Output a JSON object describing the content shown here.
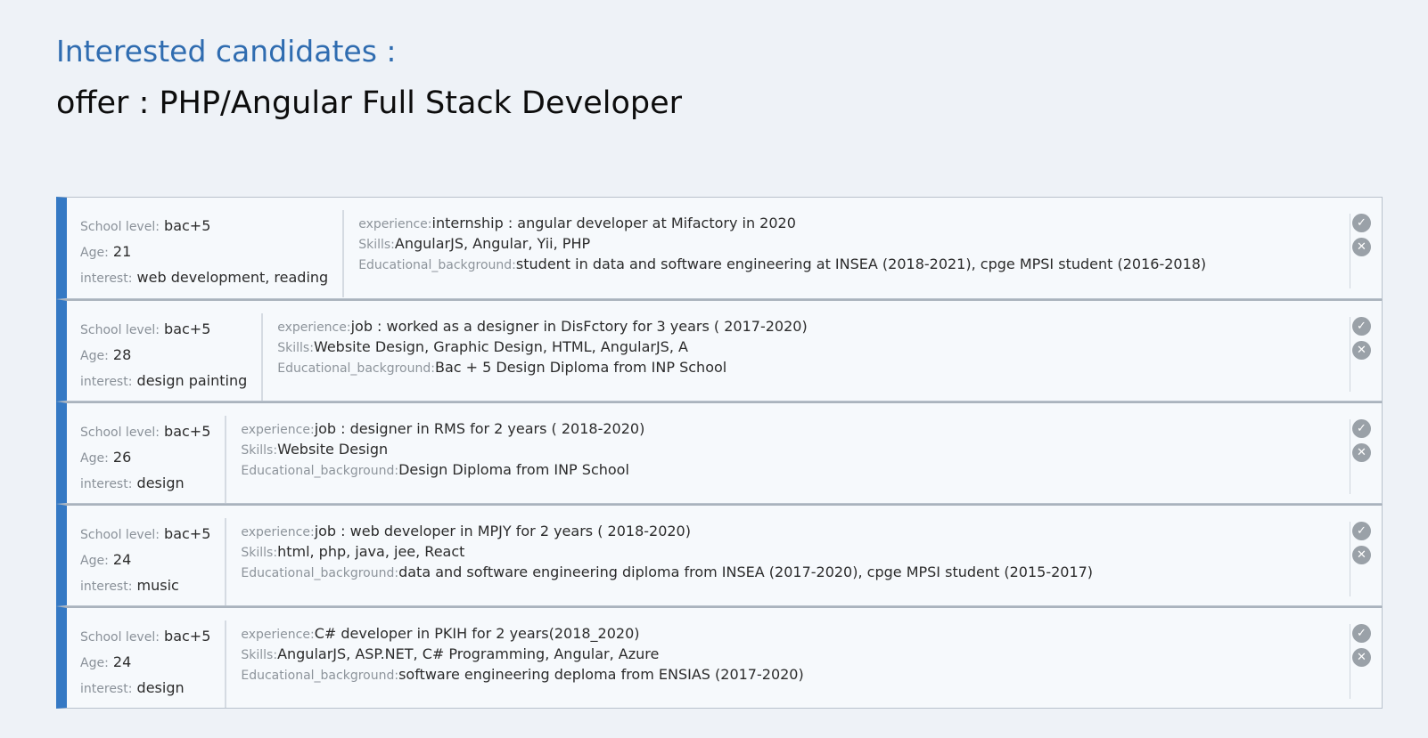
{
  "header": {
    "title": "Interested candidates :",
    "offer_prefix": "offer :",
    "offer_name": "PHP/Angular Full Stack Developer"
  },
  "labels": {
    "school_level": "School level:",
    "age": "Age:",
    "interest": "interest:",
    "experience": "experience:",
    "skills": "Skills:",
    "education": "Educational_background:"
  },
  "icons": {
    "accept": "check-circle-icon",
    "reject": "x-circle-icon"
  },
  "candidates": [
    {
      "school_level": "bac+5",
      "age": "21",
      "interest": "web development, reading",
      "experience": "internship : angular developer at Mifactory in 2020",
      "skills": "AngularJS, Angular, Yii, PHP",
      "education": "student in data and software engineering at INSEA (2018-2021), cpge MPSI student (2016-2018)"
    },
    {
      "school_level": "bac+5",
      "age": "28",
      "interest": "design painting",
      "experience": "job : worked as a designer in DisFctory for 3 years ( 2017-2020)",
      "skills": "Website Design, Graphic Design, HTML, AngularJS, A",
      "education": "Bac + 5 Design Diploma from INP School"
    },
    {
      "school_level": "bac+5",
      "age": "26",
      "interest": "design",
      "experience": "job : designer in RMS for 2 years ( 2018-2020)",
      "skills": "Website Design",
      "education": "Design Diploma from INP School"
    },
    {
      "school_level": "bac+5",
      "age": "24",
      "interest": "music",
      "experience": "job : web developer in MPJY for 2 years ( 2018-2020)",
      "skills": "html, php, java, jee, React",
      "education": "data and software engineering diploma from INSEA (2017-2020), cpge MPSI student (2015-2017)"
    },
    {
      "school_level": "bac+5",
      "age": "24",
      "interest": "design",
      "experience": "C# developer in PKIH for 2 years(2018_2020)",
      "skills": "AngularJS, ASP.NET, C# Programming, Angular, Azure",
      "education": "software engineering deploma from ENSIAS (2017-2020)"
    }
  ]
}
